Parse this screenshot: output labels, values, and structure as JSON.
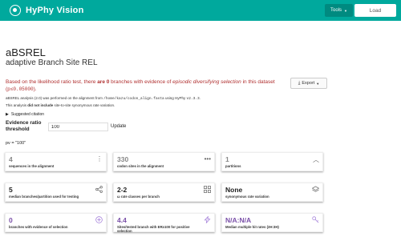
{
  "navbar": {
    "brand": "HyPhy Vision",
    "tools_label": "Tools",
    "load_label": "Load"
  },
  "header": {
    "title": "aBSREL",
    "subtitle": "adaptive Branch Site REL"
  },
  "summary": {
    "prefix": "Based on the likelihood ratio test, there ",
    "count_bold": "are 0",
    "middle": " branches with evidence of ",
    "italic": "episodic diversifying selection",
    "suffix": " in this dataset (",
    "pvalue": "p≤0.05000",
    "end": ")."
  },
  "export_label": "Export",
  "analysis_note": {
    "prefix": "aBSREL analysis (2.0) was performed on the alignment from ",
    "path": "/home/kazu/codon_align.fasta",
    "middle": " using HyPhy ",
    "version": "v2.3.3",
    "end": "."
  },
  "site_note": {
    "prefix": "This analysis ",
    "bold": "did not include",
    "suffix": " site-to-site synonymous rate variation."
  },
  "citation_label": "Suggested citation",
  "evidence": {
    "label": "Evidence ratio threshold",
    "value": "100",
    "update_label": "Update"
  },
  "pv_label": "pv = \"100\"",
  "cards": [
    {
      "value": "4",
      "label": "sequences in the alignment",
      "icon": "more-vert-icon"
    },
    {
      "value": "330",
      "label": "codon sites in the alignment",
      "icon": "more-horiz-icon"
    },
    {
      "value": "1",
      "label": "partitions",
      "icon": "chevron-up-icon"
    },
    {
      "value": "5",
      "label": "median branches/partition used for testing",
      "icon": "share-icon"
    },
    {
      "value": "2-2",
      "label": "ω rate classes per branch",
      "icon": "grid-icon"
    },
    {
      "value": "None",
      "label": "synonymous rate variation",
      "icon": "layers-icon"
    },
    {
      "value": "0",
      "label": "branches with evidence of selection",
      "icon": "plus-circle-icon"
    },
    {
      "value": "4.4",
      "label": "Sites/tested branch with ER≥100 for positive selection",
      "icon": "bolt-icon"
    },
    {
      "value": "N/A:N/A",
      "label": "Median multiple hit rates (2H:3H)",
      "icon": "key-icon"
    }
  ]
}
